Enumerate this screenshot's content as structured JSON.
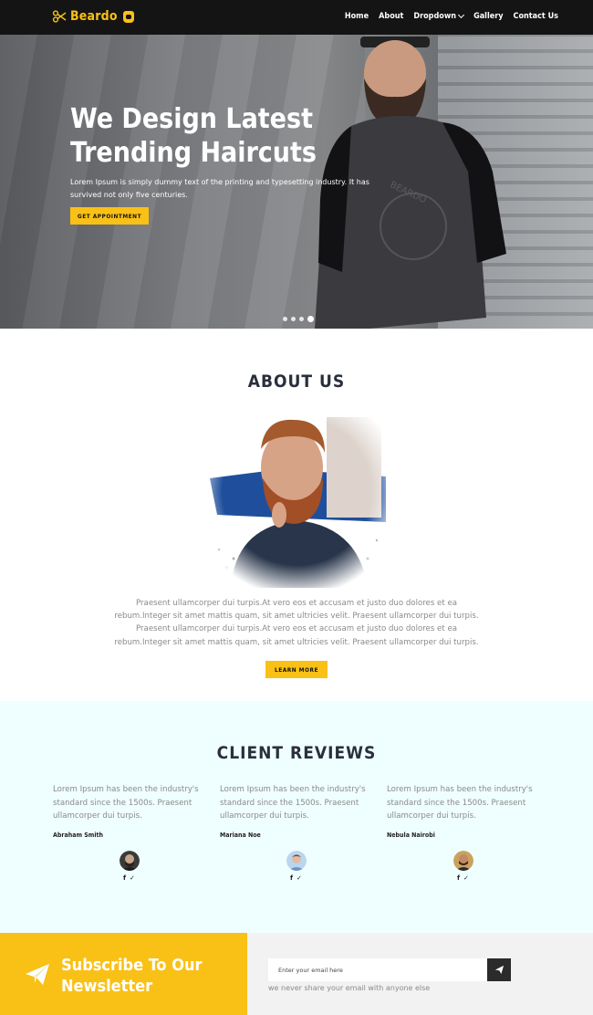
{
  "navbar": {
    "brand": "Beardo",
    "links": [
      {
        "label": "Home"
      },
      {
        "label": "About"
      },
      {
        "label": "Dropdown"
      },
      {
        "label": "Gallery"
      },
      {
        "label": "Contact Us"
      }
    ]
  },
  "hero": {
    "title_line1": "We Design Latest",
    "title_line2": "Trending Haircuts",
    "text": "Lorem Ipsum is simply dummy text of the printing and typesetting industry. It has survived not only five centuries.",
    "button": "GET APPOINTMENT",
    "slides": 4,
    "active_slide": 4
  },
  "about": {
    "title": "ABOUT US",
    "text_line1": "Praesent ullamcorper dui turpis.At vero eos et accusam et justo duo dolores et ea",
    "text_line2": "rebum.Integer sit amet mattis quam, sit amet ultricies velit. Praesent ullamcorper dui turpis.",
    "text_line3": "Praesent ullamcorper dui turpis.At vero eos et accusam et justo duo dolores et ea",
    "text_line4": "rebum.Integer sit amet mattis quam, sit amet ultricies velit. Praesent ullamcorper dui turpis.",
    "button": "LEARN MORE"
  },
  "reviews": {
    "title": "CLIENT REVIEWS",
    "items": [
      {
        "text": "Lorem Ipsum has been the industry's standard since the 1500s. Praesent ullamcorper dui turpis.",
        "name": "Abraham Smith",
        "facebook": "f",
        "twitter": "✓"
      },
      {
        "text": "Lorem Ipsum has been the industry's standard since the 1500s. Praesent ullamcorper dui turpis.",
        "name": "Mariana Noe",
        "facebook": "f",
        "twitter": "✓"
      },
      {
        "text": "Lorem Ipsum has been the industry's standard since the 1500s. Praesent ullamcorper dui turpis.",
        "name": "Nebula Nairobi",
        "facebook": "f",
        "twitter": "✓"
      }
    ]
  },
  "subscribe": {
    "title_line1": "Subscribe To Our",
    "title_line2": "Newsletter",
    "email_placeholder": "Enter your email here",
    "note": "we never share your email with anyone else"
  },
  "colors": {
    "accent": "#f9c016",
    "navbar": "#141414",
    "reviews_bg": "#effefe",
    "heading": "#2a2f3d"
  }
}
